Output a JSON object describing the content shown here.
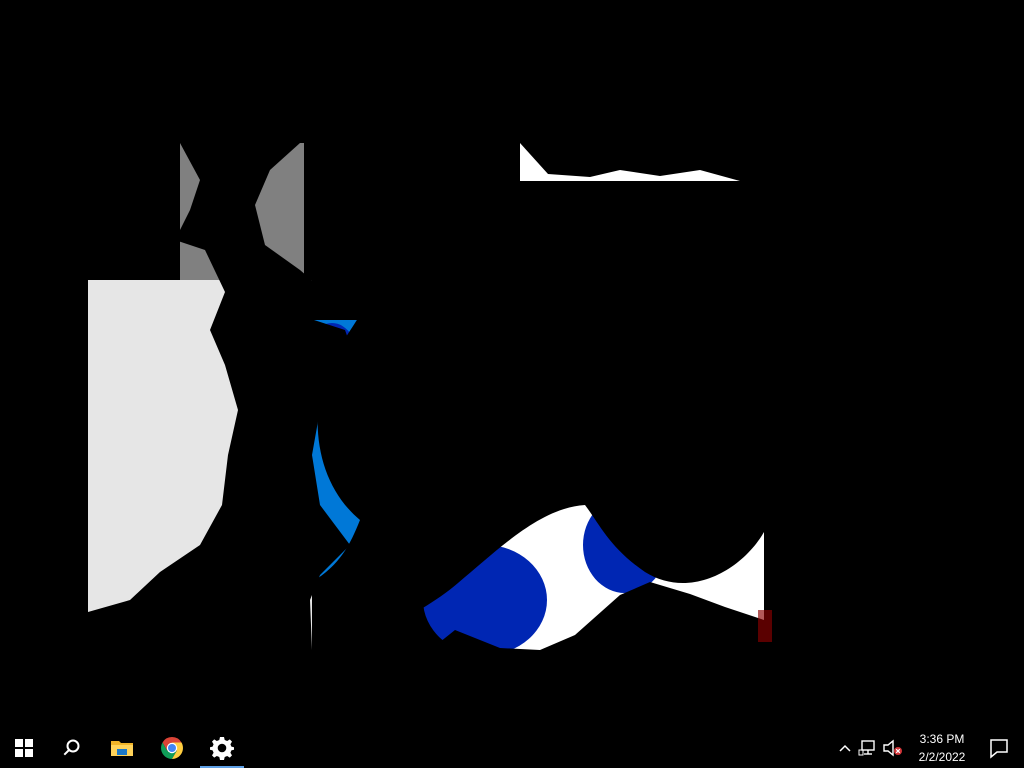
{
  "taskbar": {
    "apps": [
      {
        "name": "start",
        "icon": "windows-logo-icon"
      },
      {
        "name": "search",
        "icon": "search-icon"
      },
      {
        "name": "file-explorer",
        "icon": "folder-icon"
      },
      {
        "name": "google-chrome",
        "icon": "chrome-icon"
      },
      {
        "name": "settings",
        "icon": "gear-icon",
        "active": true
      }
    ],
    "system_tray": {
      "chevron_icon": "chevron-up-icon",
      "network_icon": "network-icon",
      "volume_icon": "volume-muted-icon"
    },
    "clock": {
      "time": "3:36 PM",
      "date": "2/2/2022"
    },
    "notification_icon": "notification-icon"
  },
  "colors": {
    "desktop_background": "#000000",
    "window_light_gray": "#e6e6e6",
    "window_mid_gray": "#808080",
    "window_white": "#ffffff",
    "window_blue": "#0026b3",
    "window_light_blue": "#0078d7",
    "active_indicator": "#5ea0e6"
  }
}
